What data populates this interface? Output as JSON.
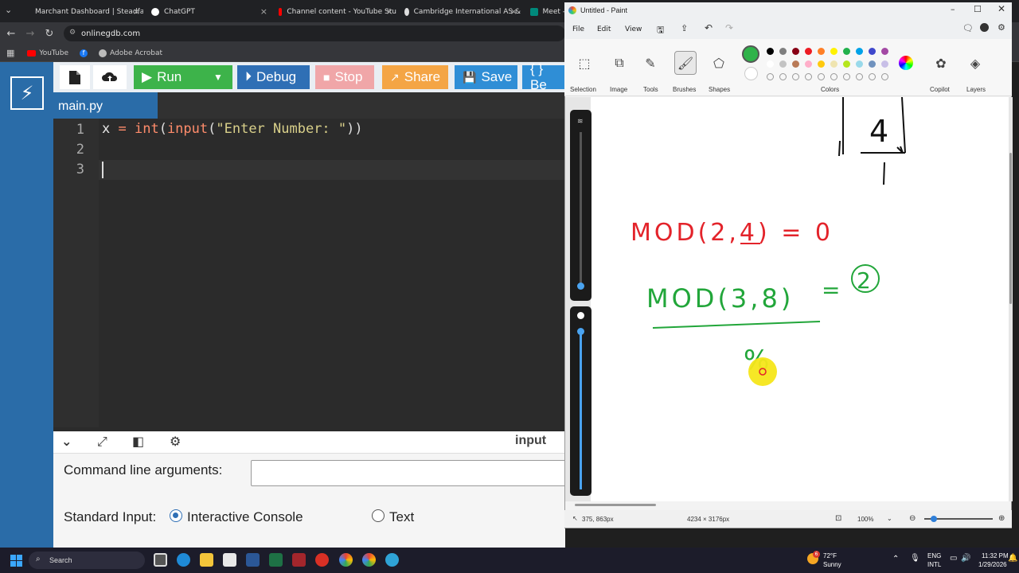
{
  "browser": {
    "tabs": [
      {
        "title": "Marchant Dashboard | Steadfa",
        "color": "#29a36a"
      },
      {
        "title": "ChatGPT",
        "color": "#ffffff"
      },
      {
        "title": "Channel content - YouTube Stu",
        "color": "#ff0000"
      },
      {
        "title": "Cambridge International AS &",
        "color": "#dddddd"
      },
      {
        "title": "Meet -",
        "color": "#00897b"
      }
    ],
    "url": "onlinegdb.com",
    "bookmarks": [
      {
        "label": "YouTube",
        "color": "#ff0000"
      },
      {
        "label": "",
        "color": "#1877f2"
      },
      {
        "label": "Adobe Acrobat",
        "color": "#cccccc"
      }
    ]
  },
  "gdb": {
    "toolbar": {
      "run": "Run",
      "debug": "Debug",
      "stop": "Stop",
      "share": "Share",
      "save": "Save",
      "beautify": "{ } Be"
    },
    "filename": "main.py",
    "line_numbers": [
      "1",
      "2",
      "3"
    ],
    "code": {
      "var": "x",
      "op": " = ",
      "fn1": "int",
      "p1": "(",
      "fn2": "input",
      "p2": "(",
      "str": "\"Enter Number: \"",
      "p3": "))"
    },
    "console": {
      "input_label": "input",
      "cmd_label": "Command line arguments:",
      "stdin_label": "Standard Input:",
      "opt_interactive": "Interactive Console",
      "opt_text": "Text"
    }
  },
  "paint": {
    "title": "Untitled - Paint",
    "menu": [
      "File",
      "Edit",
      "View"
    ],
    "ribbon": [
      "Selection",
      "Image",
      "Tools",
      "Brushes",
      "Shapes",
      "Colors",
      "Copilot",
      "Layers"
    ],
    "selected_color": "#2fb34a",
    "swatches_row1": [
      "#000000",
      "#7f7f7f",
      "#880015",
      "#ed1c24",
      "#ff7f27",
      "#fff200",
      "#22b14c",
      "#00a2e8",
      "#3f48cc",
      "#a349a4"
    ],
    "swatches_row2": [
      "#ffffff",
      "#c3c3c3",
      "#b97a57",
      "#ffaec9",
      "#ffc90e",
      "#efe4b0",
      "#b5e61d",
      "#99d9ea",
      "#7092be",
      "#c8bfe7"
    ],
    "handwriting": {
      "expr1": "MOD(2,4) = 0",
      "expr2_left": "MOD(3,8)",
      "expr2_eq": "=",
      "expr2_result": "2",
      "boxed_digit": "4",
      "percent": "%"
    },
    "status": {
      "cursor": "375, 863px",
      "canvas_size": "4234 × 3176px",
      "zoom": "100%"
    }
  },
  "taskbar": {
    "search": "Search",
    "weather_temp": "72°F",
    "weather_desc": "Sunny",
    "weather_badge": "6",
    "lang1": "ENG",
    "lang2": "INTL",
    "time": "11:32 PM",
    "date": "1/29/2026"
  }
}
